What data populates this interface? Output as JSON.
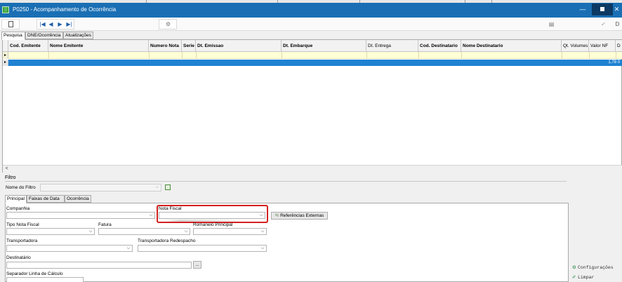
{
  "window": {
    "title": "P0250 - Acompanhamento de Ocorrência",
    "app_icon_glyph": "░",
    "min_glyph": "—",
    "close_glyph": "✕"
  },
  "toolbar": {
    "first_glyph": "|◀",
    "prev_glyph": "◀",
    "next_glyph": "▶",
    "last_glyph": "▶|",
    "settings_glyph": "⚙",
    "layout_glyph": "▤",
    "confirm_glyph": "✔",
    "edge_glyph": "D"
  },
  "tabs_top": [
    "Pesquisa",
    "DNE/Ocorrência",
    "Atualizações"
  ],
  "grid": {
    "columns": [
      "Cod. Emitente",
      "Nome Emitente",
      "Numero Nota",
      "Serie",
      "Dt. Emissao",
      "Dt. Embarque",
      "Dt. Entrega",
      "Cod. Destinatario",
      "Nome Destinatario",
      "Qt. Volumes",
      "Valor NF",
      "D"
    ],
    "filter_indicator": "▸",
    "row_indicator": "▸",
    "selected_row_value": "1,78 0",
    "scroll_left_glyph": "<"
  },
  "filter": {
    "section_title": "Filtro",
    "filter_name_label": "Nome do Filtro",
    "dropdown_glyph": "⌵"
  },
  "tabs_bottom": [
    "Principal",
    "Faixas de Data",
    "Ocorrência"
  ],
  "form": {
    "companhia_label": "Companhia",
    "nota_fiscal_label": "Nota Fiscal",
    "referencias_button": "Referências Externas",
    "tipo_nota_label": "Tipo Nota Fiscal",
    "fatura_label": "Fatura",
    "romaneio_label": "Romaneio Principal",
    "transportadora_label": "Transportadora",
    "transp_redespacho_label": "Transportadora Redespacho",
    "destinatario_label": "Destinatário",
    "browse_button": "...",
    "separador_label": "Separador Linha de Cálculo"
  },
  "side_actions": {
    "configuracoes": "Configurações",
    "limpar": "Limpar",
    "config_icon_glyph": "⚙",
    "limpar_icon_glyph": "✐"
  },
  "colors": {
    "titlebar": "#1a6fb4",
    "selected_row": "#1e82d2",
    "filter_row": "#ffffd6",
    "highlight": "#d42020"
  }
}
